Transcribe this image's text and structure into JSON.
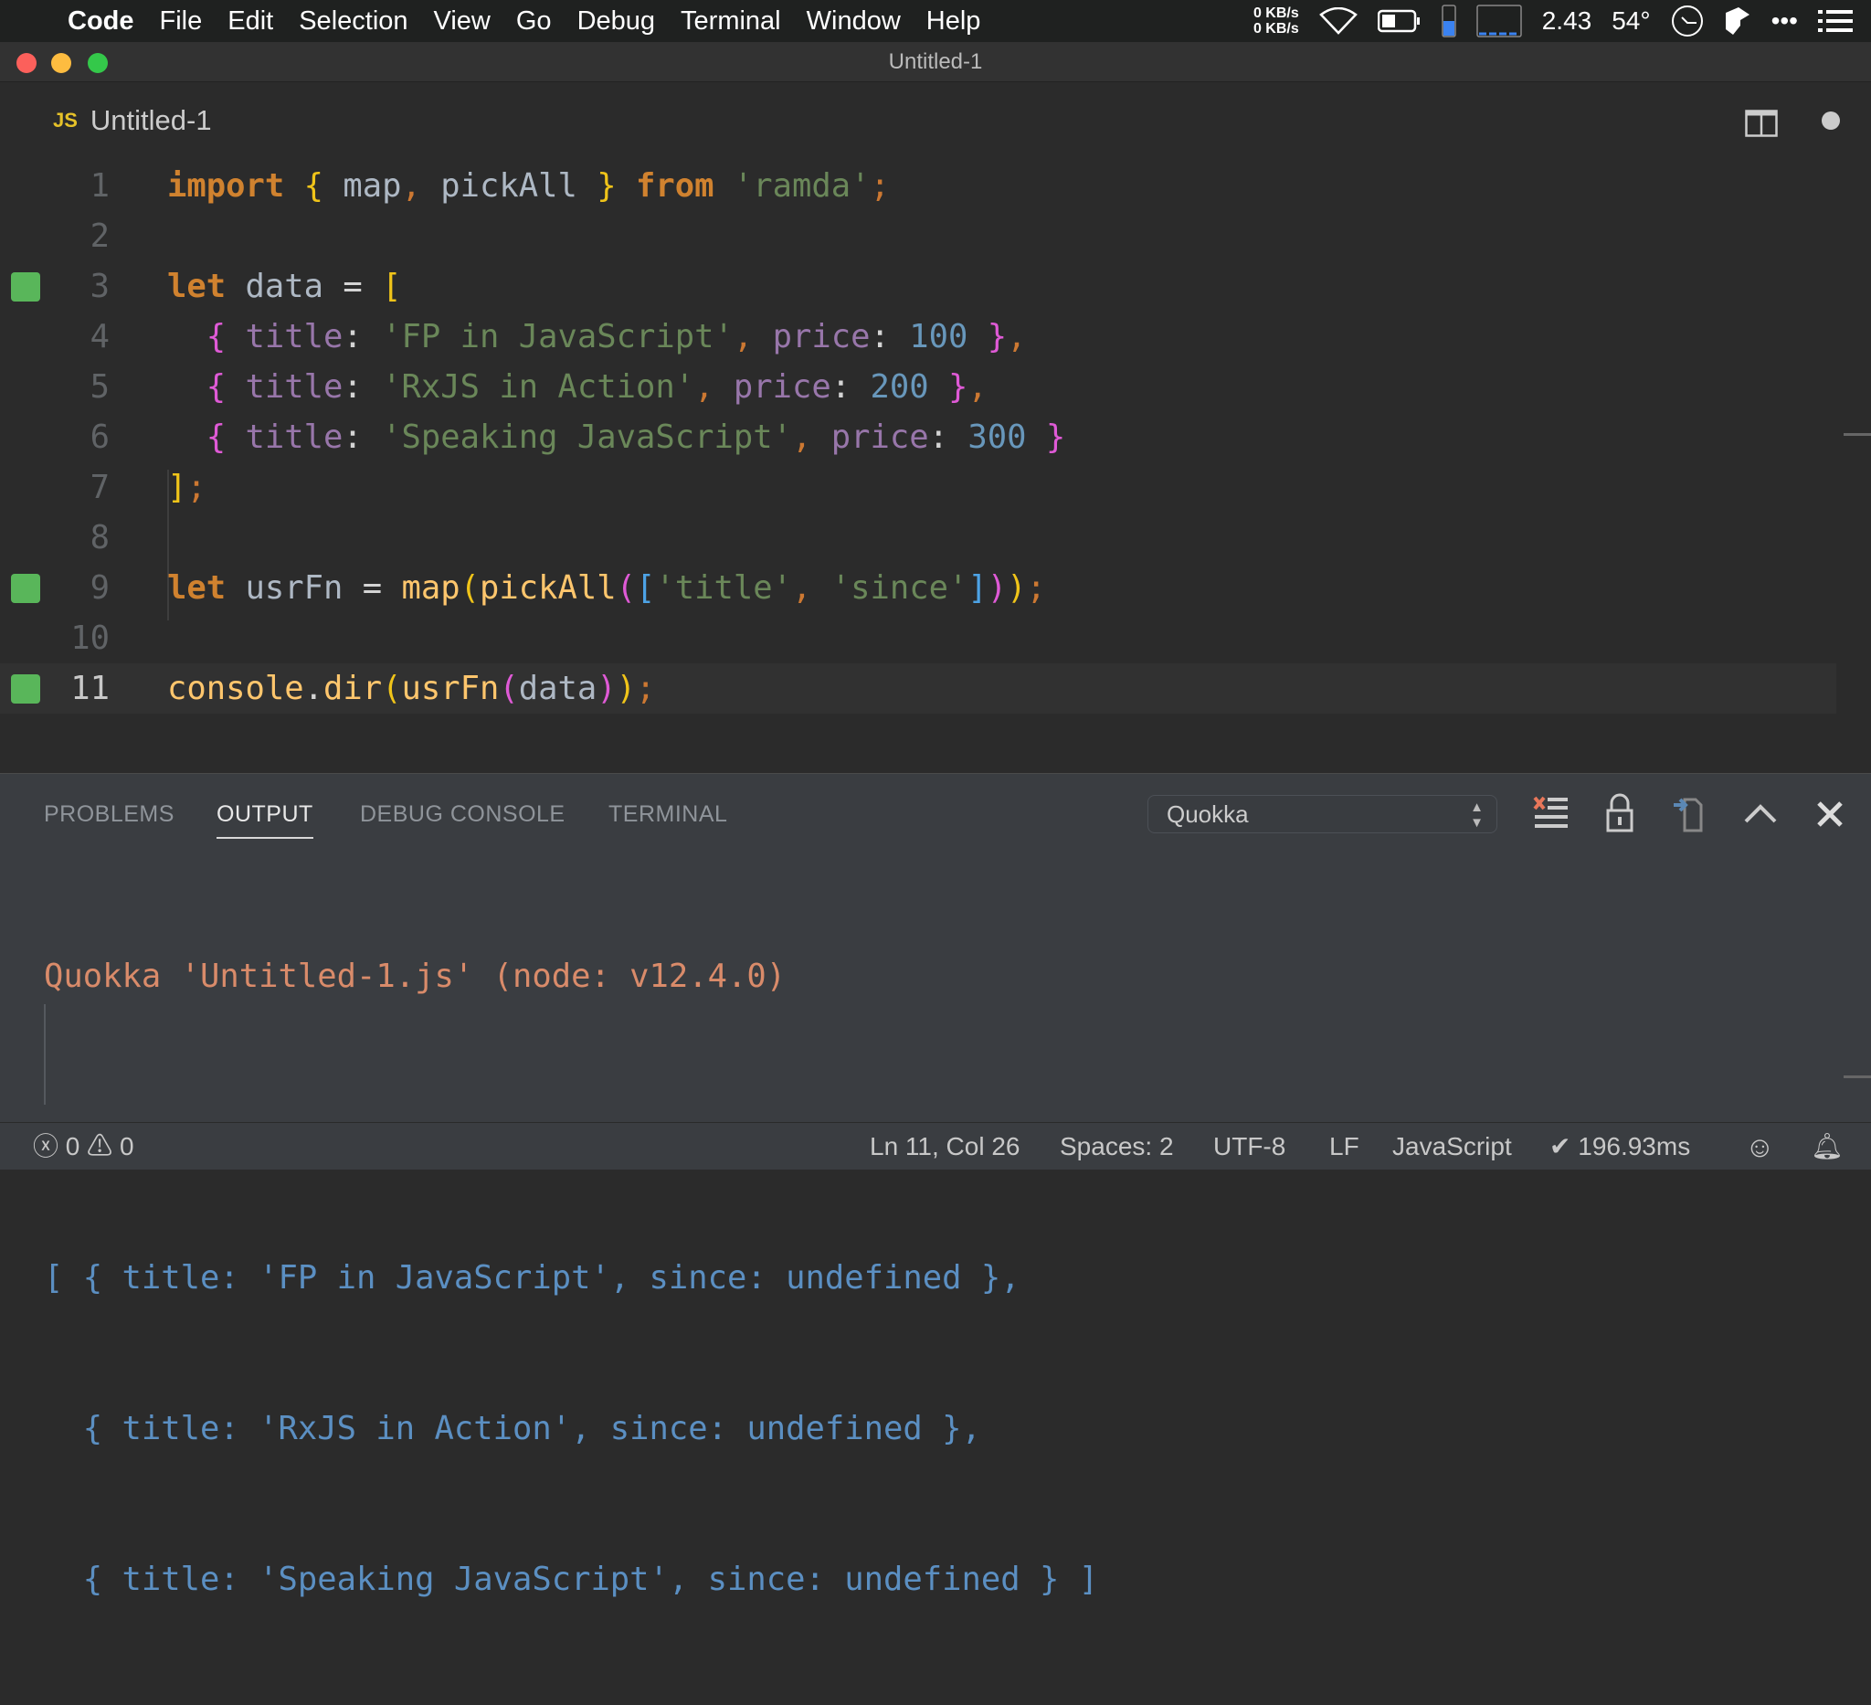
{
  "menubar": {
    "app": "Code",
    "items": [
      "File",
      "Edit",
      "Selection",
      "View",
      "Go",
      "Debug",
      "Terminal",
      "Window",
      "Help"
    ],
    "net_up": "0 KB/s",
    "net_down": "0 KB/s",
    "load": "2.43",
    "temp": "54°"
  },
  "window": {
    "title": "Untitled-1"
  },
  "tab": {
    "icon": "JS",
    "label": "Untitled-1"
  },
  "editor": {
    "current_line": 11,
    "lines": [
      {
        "n": "1",
        "mark": false,
        "t": [
          [
            "import",
            "kw"
          ],
          [
            " "
          ],
          [
            "{",
            "br"
          ],
          [
            " map",
            "id"
          ],
          [
            ",",
            "pu"
          ],
          [
            " pickAll ",
            "id"
          ],
          [
            "}",
            "br"
          ],
          [
            " "
          ],
          [
            "from",
            "kw"
          ],
          [
            " "
          ],
          [
            "'ramda'",
            "st"
          ],
          [
            ";",
            "pu"
          ]
        ]
      },
      {
        "n": "2",
        "mark": false,
        "t": []
      },
      {
        "n": "3",
        "mark": true,
        "t": [
          [
            "let",
            "kw"
          ],
          [
            " data ",
            "id"
          ],
          [
            "=",
            "op"
          ],
          [
            " "
          ],
          [
            "[",
            "br"
          ]
        ]
      },
      {
        "n": "4",
        "mark": false,
        "t": [
          [
            "  "
          ],
          [
            "{",
            "pk"
          ],
          [
            " "
          ],
          [
            "title",
            "pr"
          ],
          [
            ":",
            "op"
          ],
          [
            " "
          ],
          [
            "'FP in JavaScript'",
            "st"
          ],
          [
            ",",
            "pu"
          ],
          [
            " "
          ],
          [
            "price",
            "pr"
          ],
          [
            ":",
            "op"
          ],
          [
            " "
          ],
          [
            "100",
            "nu"
          ],
          [
            " "
          ],
          [
            "}",
            "pk"
          ],
          [
            ",",
            "pu"
          ]
        ]
      },
      {
        "n": "5",
        "mark": false,
        "t": [
          [
            "  "
          ],
          [
            "{",
            "pk"
          ],
          [
            " "
          ],
          [
            "title",
            "pr"
          ],
          [
            ":",
            "op"
          ],
          [
            " "
          ],
          [
            "'RxJS in Action'",
            "st"
          ],
          [
            ",",
            "pu"
          ],
          [
            " "
          ],
          [
            "price",
            "pr"
          ],
          [
            ":",
            "op"
          ],
          [
            " "
          ],
          [
            "200",
            "nu"
          ],
          [
            " "
          ],
          [
            "}",
            "pk"
          ],
          [
            ",",
            "pu"
          ]
        ]
      },
      {
        "n": "6",
        "mark": false,
        "t": [
          [
            "  "
          ],
          [
            "{",
            "pk"
          ],
          [
            " "
          ],
          [
            "title",
            "pr"
          ],
          [
            ":",
            "op"
          ],
          [
            " "
          ],
          [
            "'Speaking JavaScript'",
            "st"
          ],
          [
            ",",
            "pu"
          ],
          [
            " "
          ],
          [
            "price",
            "pr"
          ],
          [
            ":",
            "op"
          ],
          [
            " "
          ],
          [
            "300",
            "nu"
          ],
          [
            " "
          ],
          [
            "}",
            "pk"
          ]
        ]
      },
      {
        "n": "7",
        "mark": false,
        "t": [
          [
            "]",
            "br"
          ],
          [
            ";",
            "pu"
          ]
        ]
      },
      {
        "n": "8",
        "mark": false,
        "t": []
      },
      {
        "n": "9",
        "mark": true,
        "t": [
          [
            "let",
            "kw"
          ],
          [
            " usrFn ",
            "id"
          ],
          [
            "=",
            "op"
          ],
          [
            " "
          ],
          [
            "map",
            "fn"
          ],
          [
            "(",
            "br"
          ],
          [
            "pickAll",
            "fn"
          ],
          [
            "(",
            "pk"
          ],
          [
            "[",
            "sq"
          ],
          [
            "'title'",
            "st"
          ],
          [
            ",",
            "pu"
          ],
          [
            " "
          ],
          [
            "'since'",
            "st"
          ],
          [
            "]",
            "sq"
          ],
          [
            ")",
            "pk"
          ],
          [
            ")",
            "br"
          ],
          [
            ";",
            "pu"
          ]
        ]
      },
      {
        "n": "10",
        "mark": false,
        "t": []
      },
      {
        "n": "11",
        "mark": true,
        "t": [
          [
            "console",
            "fn"
          ],
          [
            ".",
            "op"
          ],
          [
            "dir",
            "fn"
          ],
          [
            "(",
            "br"
          ],
          [
            "usrFn",
            "fn"
          ],
          [
            "(",
            "pk"
          ],
          [
            "data",
            "id"
          ],
          [
            ")",
            "pk"
          ],
          [
            ")",
            "br"
          ],
          [
            ";",
            "pu"
          ]
        ]
      }
    ]
  },
  "panel": {
    "tabs": [
      "PROBLEMS",
      "OUTPUT",
      "DEBUG CONSOLE",
      "TERMINAL"
    ],
    "active_tab": "OUTPUT",
    "channel": "Quokka",
    "output": {
      "header": "Quokka 'Untitled-1.js' (node: v12.4.0)",
      "lines": [
        "[ { title: 'FP in JavaScript', since: undefined },",
        "  { title: 'RxJS in Action', since: undefined },",
        "  { title: 'Speaking JavaScript', since: undefined } ]"
      ]
    }
  },
  "statusbar": {
    "errors": "0",
    "warnings": "0",
    "position": "Ln 11, Col 26",
    "spaces": "Spaces: 2",
    "encoding": "UTF-8",
    "eol": "LF",
    "language": "JavaScript",
    "timing": "✔ 196.93ms"
  }
}
